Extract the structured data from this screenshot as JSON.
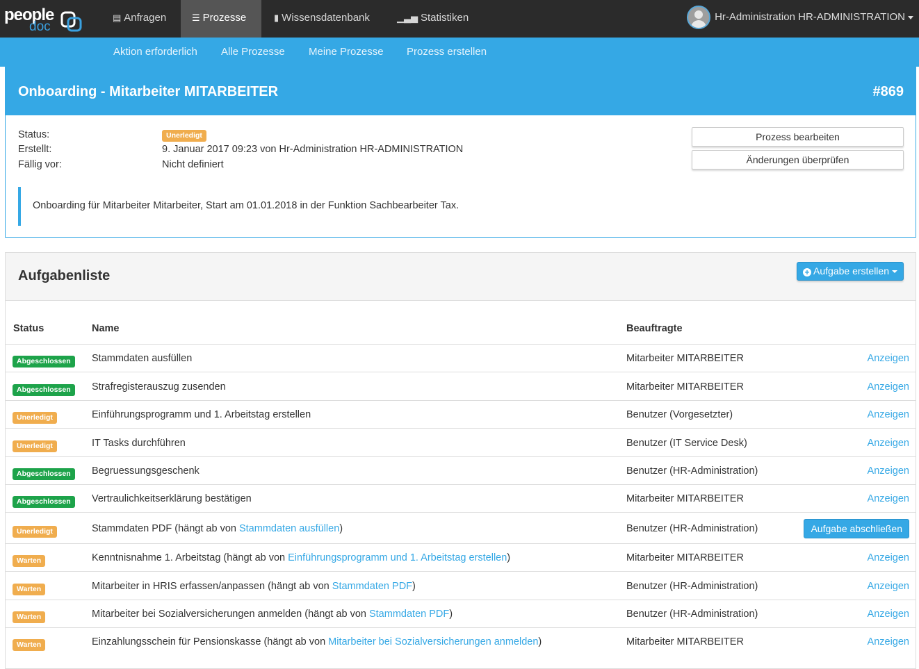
{
  "app": {
    "logo_text_top": "people",
    "logo_text_bottom": "doc"
  },
  "nav": {
    "items": [
      {
        "label": "Anfragen",
        "icon": "inbox-icon"
      },
      {
        "label": "Prozesse",
        "icon": "list-icon",
        "active": true
      },
      {
        "label": "Wissensdatenbank",
        "icon": "book-icon"
      },
      {
        "label": "Statistiken",
        "icon": "bar-chart-icon"
      }
    ],
    "user": "Hr-Administration HR-ADMINISTRATION"
  },
  "subnav": {
    "items": [
      "Aktion erforderlich",
      "Alle Prozesse",
      "Meine Prozesse",
      "Prozess erstellen"
    ]
  },
  "process": {
    "title": "Onboarding - Mitarbeiter MITARBEITER",
    "id": "#869",
    "status_label": "Status:",
    "status_value": "Unerledigt",
    "created_label": "Erstellt:",
    "created_value": "9. Januar 2017 09:23 von Hr-Administration HR-ADMINISTRATION",
    "due_label": "Fällig vor:",
    "due_value": "Nicht definiert",
    "edit_button": "Prozess bearbeiten",
    "review_button": "Änderungen überprüfen",
    "description": "Onboarding für Mitarbeiter Mitarbeiter, Start am 01.01.2018 in der Funktion Sachbearbeiter Tax.",
    "colors": {
      "primary": "#35a8e5",
      "warning": "#f0ad4e",
      "success": "#1da34a"
    }
  },
  "tasks": {
    "title": "Aufgabenliste",
    "create_button": "Aufgabe erstellen",
    "columns": {
      "status": "Status",
      "name": "Name",
      "assignee": "Beauftragte"
    },
    "rows": [
      {
        "status": "Abgeschlossen",
        "name": "Stammdaten ausfüllen",
        "dep": "",
        "assignee": "Mitarbeiter MITARBEITER",
        "action": "Anzeigen"
      },
      {
        "status": "Abgeschlossen",
        "name": "Strafregisterauszug zusenden",
        "dep": "",
        "assignee": "Mitarbeiter MITARBEITER",
        "action": "Anzeigen"
      },
      {
        "status": "Unerledigt",
        "name": "Einführungsprogramm und 1. Arbeitstag erstellen",
        "dep": "",
        "assignee": "Benutzer (Vorgesetzter)",
        "action": "Anzeigen"
      },
      {
        "status": "Unerledigt",
        "name": "IT Tasks durchführen",
        "dep": "",
        "assignee": "Benutzer (IT Service Desk)",
        "action": "Anzeigen"
      },
      {
        "status": "Abgeschlossen",
        "name": "Begruessungsgeschenk",
        "dep": "",
        "assignee": "Benutzer (HR-Administration)",
        "action": "Anzeigen"
      },
      {
        "status": "Abgeschlossen",
        "name": "Vertraulichkeitserklärung bestätigen",
        "dep": "",
        "assignee": "Mitarbeiter MITARBEITER",
        "action": "Anzeigen"
      },
      {
        "status": "Unerledigt",
        "name": "Stammdaten PDF (hängt ab von ",
        "dep": "Stammdaten ausfüllen",
        "assignee": "Benutzer (HR-Administration)",
        "action": "Aufgabe abschließen",
        "action_is_button": true
      },
      {
        "status": "Warten",
        "name": "Kenntnisnahme 1. Arbeitstag (hängt ab von ",
        "dep": "Einführungsprogramm und 1. Arbeitstag erstellen",
        "assignee": "Mitarbeiter MITARBEITER",
        "action": "Anzeigen"
      },
      {
        "status": "Warten",
        "name": "Mitarbeiter in HRIS erfassen/anpassen (hängt ab von ",
        "dep": "Stammdaten PDF",
        "assignee": "Benutzer (HR-Administration)",
        "action": "Anzeigen"
      },
      {
        "status": "Warten",
        "name": "Mitarbeiter bei Sozialversicherungen anmelden (hängt ab von ",
        "dep": "Stammdaten PDF",
        "assignee": "Benutzer (HR-Administration)",
        "action": "Anzeigen"
      },
      {
        "status": "Warten",
        "name": "Einzahlungsschein für Pensionskasse (hängt ab von ",
        "dep": "Mitarbeiter bei Sozialversicherungen anmelden",
        "assignee": "Mitarbeiter MITARBEITER",
        "action": "Anzeigen"
      }
    ]
  }
}
